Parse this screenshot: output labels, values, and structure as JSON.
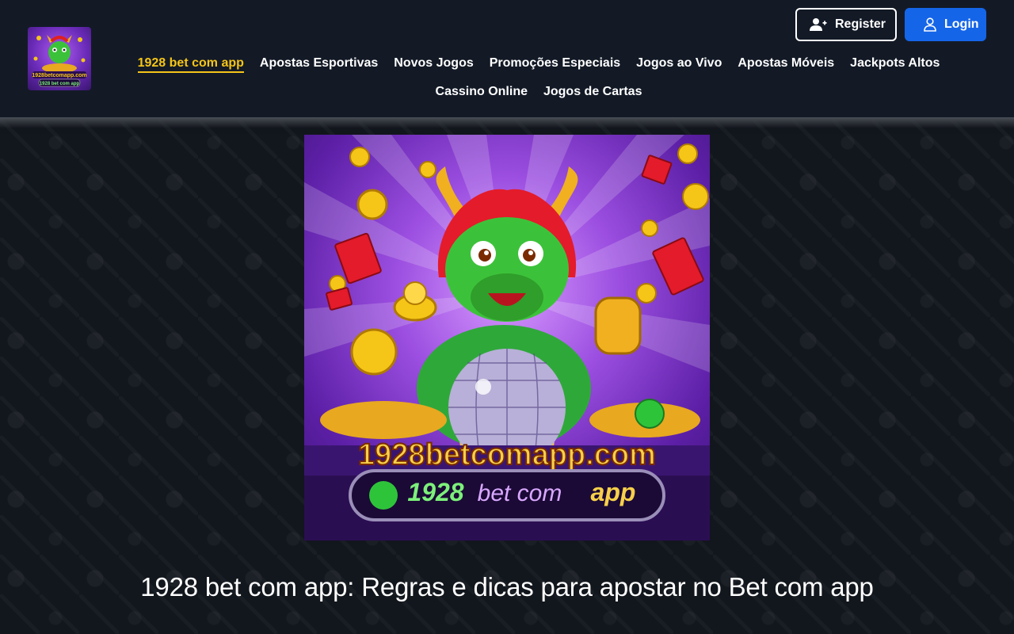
{
  "header": {
    "logo_alt": "1928betcomapp.com",
    "logo_text_line1": "1928betcomapp.com",
    "logo_text_line2": "1928 bet com app",
    "register_label": "Register",
    "login_label": "Login"
  },
  "nav": {
    "items": [
      {
        "label": "1928 bet com app",
        "active": true
      },
      {
        "label": "Apostas Esportivas"
      },
      {
        "label": "Novos Jogos"
      },
      {
        "label": "Promoções Especiais"
      },
      {
        "label": "Jogos ao Vivo"
      },
      {
        "label": "Apostas Móveis"
      },
      {
        "label": "Jackpots Altos"
      },
      {
        "label": "Cassino Online"
      },
      {
        "label": "Jogos de Cartas"
      }
    ]
  },
  "hero": {
    "banner_domain": "1928betcomapp.com",
    "banner_num": "1928",
    "banner_bet": "bet com",
    "banner_app": "app"
  },
  "article": {
    "title": "1928 bet com app: Regras e dicas para apostar no Bet com app"
  },
  "colors": {
    "background": "#12161d",
    "header": "#131a26",
    "accent_yellow": "#f5c518",
    "login_blue": "#1565e8"
  }
}
